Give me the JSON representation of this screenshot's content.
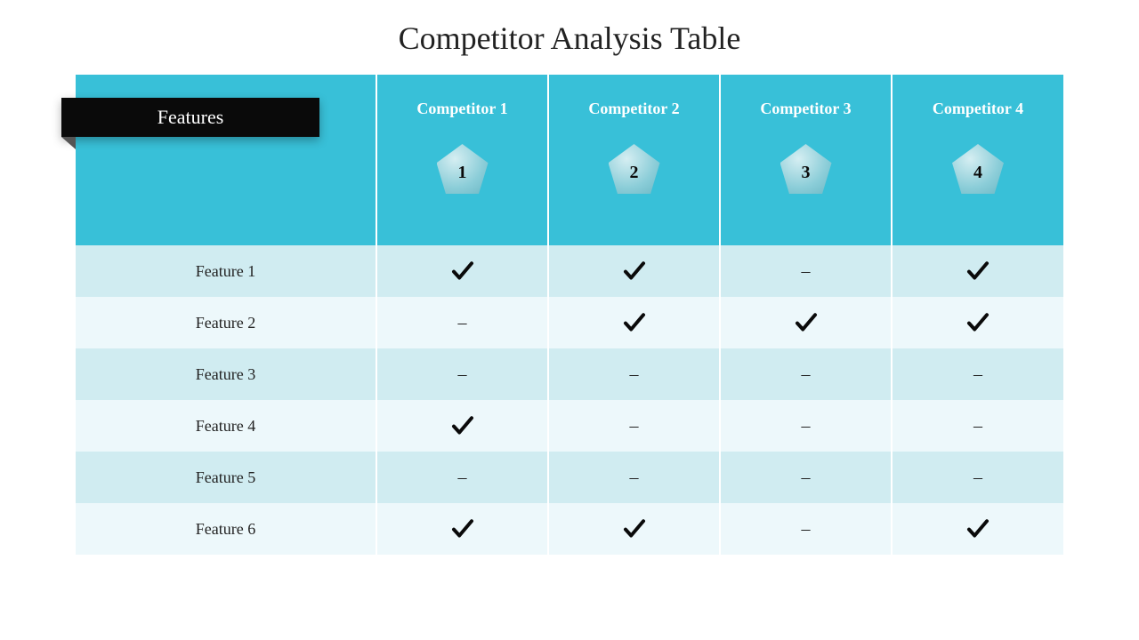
{
  "title": "Competitor Analysis Table",
  "features_label": "Features",
  "chart_data": {
    "type": "table",
    "columns": [
      {
        "label": "Competitor  1",
        "tag": "1"
      },
      {
        "label": "Competitor 2",
        "tag": "2"
      },
      {
        "label": "Competitor 3",
        "tag": "3"
      },
      {
        "label": "Competitor 4",
        "tag": "4"
      }
    ],
    "rows": [
      {
        "label": "Feature 1",
        "cells": [
          "check",
          "check",
          "dash",
          "check"
        ]
      },
      {
        "label": "Feature 2",
        "cells": [
          "dash",
          "check",
          "check",
          "check"
        ]
      },
      {
        "label": "Feature 3",
        "cells": [
          "dash",
          "dash",
          "dash",
          "dash"
        ]
      },
      {
        "label": "Feature 4",
        "cells": [
          "check",
          "dash",
          "dash",
          "dash"
        ]
      },
      {
        "label": "Feature 5",
        "cells": [
          "dash",
          "dash",
          "dash",
          "dash"
        ]
      },
      {
        "label": "Feature 6",
        "cells": [
          "check",
          "check",
          "dash",
          "check"
        ]
      }
    ]
  }
}
